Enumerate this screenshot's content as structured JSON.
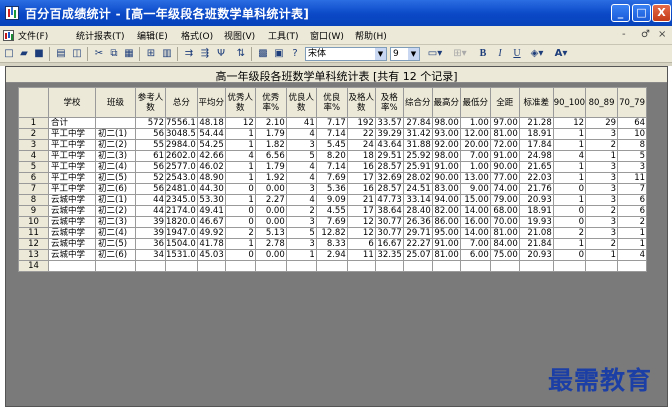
{
  "window": {
    "title": "百分百成绩统计 - [高一年级段各班数学单科统计表]",
    "controls": {
      "minimize": "_",
      "maximize": "□",
      "close": "X"
    }
  },
  "menubar": {
    "items": [
      "文件(F)",
      "统计报表(T)",
      "编辑(E)",
      "格式(O)",
      "视图(V)",
      "工具(T)",
      "窗口(W)",
      "帮助(H)"
    ],
    "mdi_controls": [
      "-",
      "♂",
      "×"
    ]
  },
  "toolbar": {
    "font_name": "宋体",
    "font_size": "9",
    "bold": "B",
    "italic": "I",
    "underline": "U"
  },
  "sheet": {
    "title": "高一年级段各班数学单科统计表  [共有 12 个记录]"
  },
  "table": {
    "headers": [
      "学校",
      "班级",
      "参考人数",
      "总分",
      "平均分",
      "优秀人数",
      "优秀率%",
      "优良人数",
      "优良率%",
      "及格人数",
      "及格率%",
      "综合分",
      "最高分",
      "最低分",
      "全距",
      "标准差",
      "90_100",
      "80_89",
      "70_79"
    ],
    "rows": [
      {
        "n": "1",
        "cells": [
          "合计",
          "",
          "572",
          "7556.1",
          "48.18",
          "12",
          "2.10",
          "41",
          "7.17",
          "192",
          "33.57",
          "27.84",
          "98.00",
          "1.00",
          "97.00",
          "21.28",
          "12",
          "29",
          "64"
        ]
      },
      {
        "n": "2",
        "cells": [
          "平工中学",
          "初二(1)",
          "56",
          "3048.5",
          "54.44",
          "1",
          "1.79",
          "4",
          "7.14",
          "22",
          "39.29",
          "31.42",
          "93.00",
          "12.00",
          "81.00",
          "18.91",
          "1",
          "3",
          "10"
        ]
      },
      {
        "n": "3",
        "cells": [
          "平工中学",
          "初二(2)",
          "55",
          "2984.0",
          "54.25",
          "1",
          "1.82",
          "3",
          "5.45",
          "24",
          "43.64",
          "31.88",
          "92.00",
          "20.00",
          "72.00",
          "17.84",
          "1",
          "2",
          "8"
        ]
      },
      {
        "n": "4",
        "cells": [
          "平工中学",
          "初二(3)",
          "61",
          "2602.0",
          "42.66",
          "4",
          "6.56",
          "5",
          "8.20",
          "18",
          "29.51",
          "25.92",
          "98.00",
          "7.00",
          "91.00",
          "24.98",
          "4",
          "1",
          "5"
        ]
      },
      {
        "n": "5",
        "cells": [
          "平工中学",
          "初二(4)",
          "56",
          "2577.0",
          "46.02",
          "1",
          "1.79",
          "4",
          "7.14",
          "16",
          "28.57",
          "25.91",
          "91.00",
          "1.00",
          "90.00",
          "21.65",
          "1",
          "3",
          "3"
        ]
      },
      {
        "n": "6",
        "cells": [
          "平工中学",
          "初二(5)",
          "52",
          "2543.0",
          "48.90",
          "1",
          "1.92",
          "4",
          "7.69",
          "17",
          "32.69",
          "28.02",
          "90.00",
          "13.00",
          "77.00",
          "22.03",
          "1",
          "3",
          "11"
        ]
      },
      {
        "n": "7",
        "cells": [
          "平工中学",
          "初二(6)",
          "56",
          "2481.0",
          "44.30",
          "0",
          "0.00",
          "3",
          "5.36",
          "16",
          "28.57",
          "24.51",
          "83.00",
          "9.00",
          "74.00",
          "21.76",
          "0",
          "3",
          "7"
        ]
      },
      {
        "n": "8",
        "cells": [
          "云城中学",
          "初二(1)",
          "44",
          "2345.0",
          "53.30",
          "1",
          "2.27",
          "4",
          "9.09",
          "21",
          "47.73",
          "33.14",
          "94.00",
          "15.00",
          "79.00",
          "20.93",
          "1",
          "3",
          "6"
        ]
      },
      {
        "n": "9",
        "cells": [
          "云城中学",
          "初二(2)",
          "44",
          "2174.0",
          "49.41",
          "0",
          "0.00",
          "2",
          "4.55",
          "17",
          "38.64",
          "28.40",
          "82.00",
          "14.00",
          "68.00",
          "18.91",
          "0",
          "2",
          "6"
        ]
      },
      {
        "n": "10",
        "cells": [
          "云城中学",
          "初二(3)",
          "39",
          "1820.0",
          "46.67",
          "0",
          "0.00",
          "3",
          "7.69",
          "12",
          "30.77",
          "26.36",
          "86.00",
          "16.00",
          "70.00",
          "19.93",
          "0",
          "3",
          "2"
        ]
      },
      {
        "n": "11",
        "cells": [
          "云城中学",
          "初二(4)",
          "39",
          "1947.0",
          "49.92",
          "2",
          "5.13",
          "5",
          "12.82",
          "12",
          "30.77",
          "29.71",
          "95.00",
          "14.00",
          "81.00",
          "21.08",
          "2",
          "3",
          "1"
        ]
      },
      {
        "n": "12",
        "cells": [
          "云城中学",
          "初二(5)",
          "36",
          "1504.0",
          "41.78",
          "1",
          "2.78",
          "3",
          "8.33",
          "6",
          "16.67",
          "22.27",
          "91.00",
          "7.00",
          "84.00",
          "21.84",
          "1",
          "2",
          "1"
        ]
      },
      {
        "n": "13",
        "cells": [
          "云城中学",
          "初二(6)",
          "34",
          "1531.0",
          "45.03",
          "0",
          "0.00",
          "1",
          "2.94",
          "11",
          "32.35",
          "25.07",
          "81.00",
          "6.00",
          "75.00",
          "20.93",
          "0",
          "1",
          "4"
        ]
      },
      {
        "n": "14",
        "cells": [
          "",
          "",
          "",
          "",
          "",
          "",
          "",
          "",
          "",
          "",
          "",
          "",
          "",
          "",
          "",
          "",
          "",
          "",
          ""
        ]
      }
    ]
  },
  "watermark": {
    "text": "最需教育"
  },
  "colors": {
    "titlebar": "#0a48c7",
    "chrome": "#ece9d8",
    "workspace": "#7a7a7a"
  }
}
